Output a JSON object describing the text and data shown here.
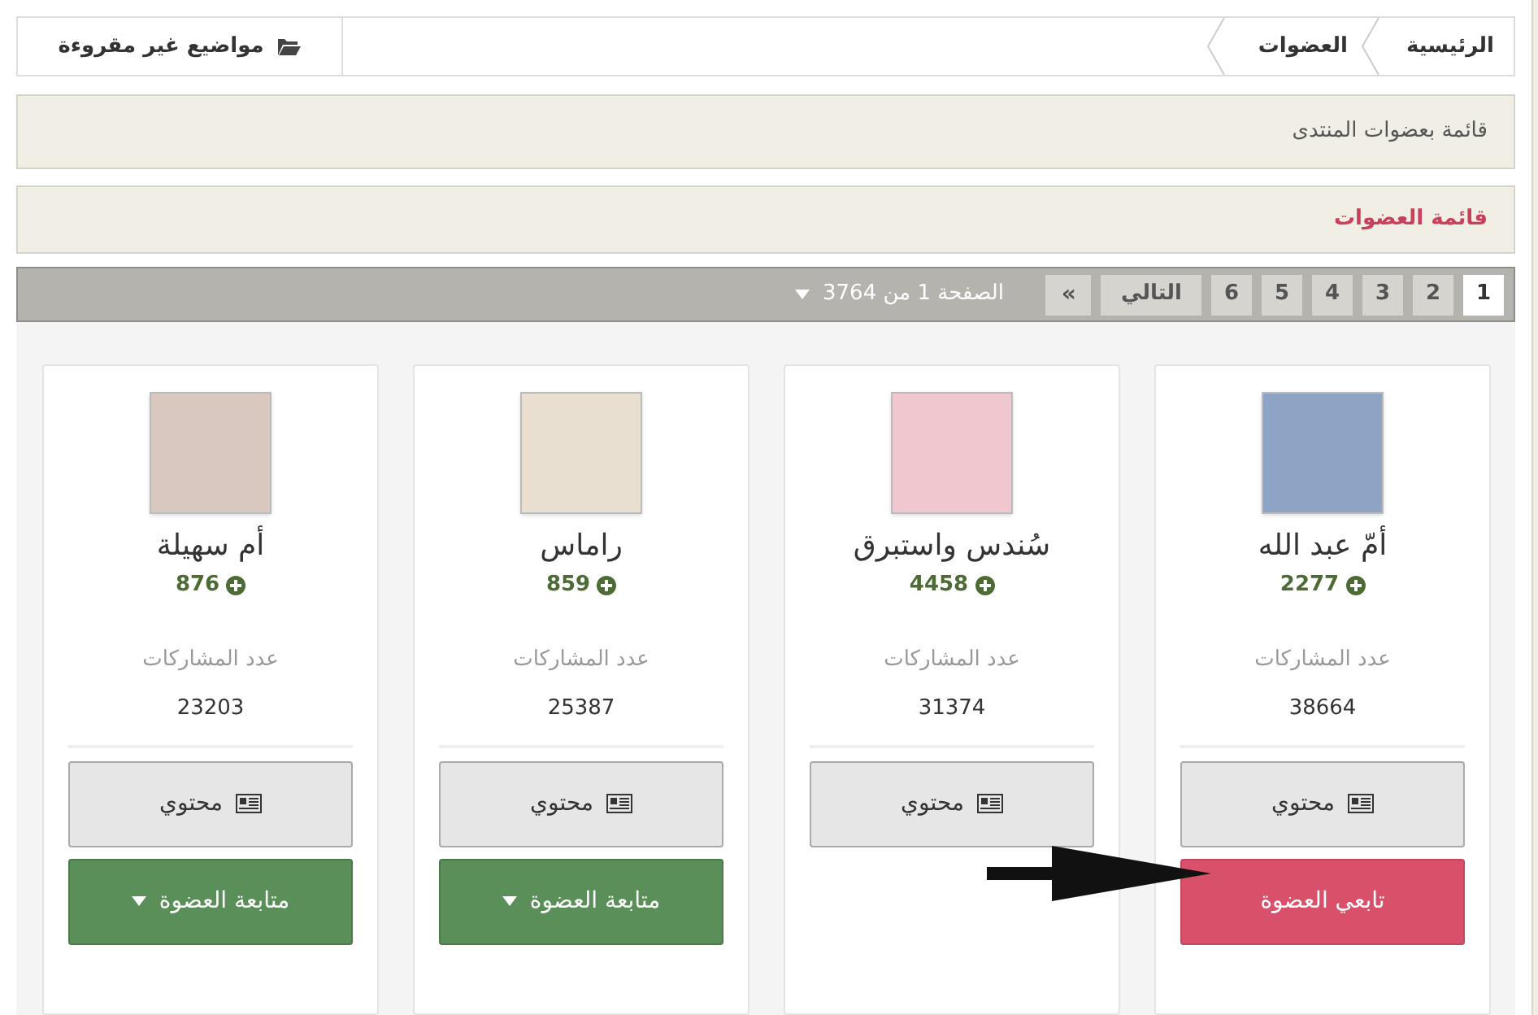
{
  "breadcrumb": [
    {
      "label": "الرئيسية"
    },
    {
      "label": "العضوات"
    }
  ],
  "unread_link": "مواضيع غير مقروءة",
  "description": "قائمة بعضوات المنتدى",
  "section_title": "قائمة العضوات",
  "pagination": {
    "pages": [
      {
        "label": "1",
        "selected": true
      },
      {
        "label": "2",
        "selected": false
      },
      {
        "label": "3",
        "selected": false
      },
      {
        "label": "4",
        "selected": false
      },
      {
        "label": "5",
        "selected": false
      },
      {
        "label": "6",
        "selected": false
      }
    ],
    "next": "التالي",
    "last": "»",
    "page_info": "الصفحة 1 من 3764"
  },
  "members": [
    {
      "name": "أمّ عبد الله",
      "points": "2277",
      "posts_label": "عدد المشاركات",
      "posts": "38664",
      "content_button": "محتوي",
      "follow": {
        "kind": "follow",
        "label": "تابعي العضوة"
      }
    },
    {
      "name": "سُندس واستبرق",
      "points": "4458",
      "posts_label": "عدد المشاركات",
      "posts": "31374",
      "content_button": "محتوي"
    },
    {
      "name": "راماس",
      "points": "859",
      "posts_label": "عدد المشاركات",
      "posts": "25387",
      "content_button": "محتوي",
      "follow": {
        "kind": "following",
        "label": "متابعة العضوة"
      }
    },
    {
      "name": "أم سهيلة",
      "points": "876",
      "posts_label": "عدد المشاركات",
      "posts": "23203",
      "content_button": "محتوي",
      "follow": {
        "kind": "following",
        "label": "متابعة العضوة"
      }
    }
  ]
}
